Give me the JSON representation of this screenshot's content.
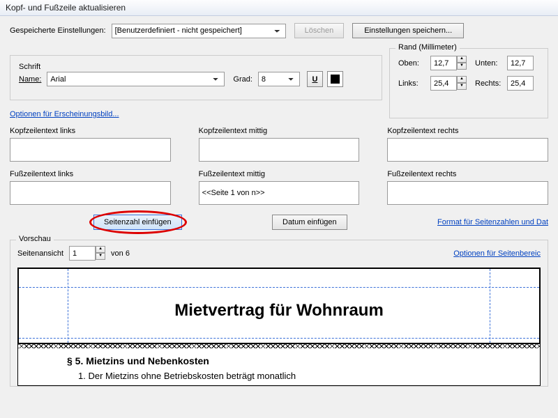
{
  "title": "Kopf- und Fußzeile aktualisieren",
  "saved": {
    "label": "Gespeicherte Einstellungen:",
    "value": "[Benutzerdefiniert - nicht gespeichert]",
    "delete": "Löschen",
    "save": "Einstellungen speichern..."
  },
  "font": {
    "legend": "Schrift",
    "name_label": "Name:",
    "name_value": "Arial",
    "grad_label": "Grad:",
    "grad_value": "8",
    "underline_icon": "U",
    "options_link": "Optionen für Erscheinungsbild..."
  },
  "margin": {
    "legend": "Rand (Millimeter)",
    "top_label": "Oben:",
    "top_value": "12,7",
    "bottom_label": "Unten:",
    "bottom_value": "12,7",
    "left_label": "Links:",
    "left_value": "25,4",
    "right_label": "Rechts:",
    "right_value": "25,4"
  },
  "hf": {
    "hl": "Kopfzeilentext links",
    "hc": "Kopfzeilentext mittig",
    "hr": "Kopfzeilentext rechts",
    "fl": "Fußzeilentext links",
    "fc": "Fußzeilentext mittig",
    "fr": "Fußzeilentext rechts",
    "hl_v": "",
    "hc_v": "",
    "hr_v": "",
    "fl_v": "",
    "fc_v": "<<Seite 1 von n>>",
    "fr_v": ""
  },
  "buttons": {
    "insert_page": "Seitenzahl einfügen",
    "insert_date": "Datum einfügen",
    "format_link": "Format für Seitenzahlen und Dat"
  },
  "preview": {
    "legend": "Vorschau",
    "pageview_label": "Seitenansicht",
    "page_value": "1",
    "of_label": "von 6",
    "range_link": "Optionen für Seitenbereic",
    "doc_title": "Mietvertrag für Wohnraum",
    "section_heading": "§ 5.   Mietzins und Nebenkosten",
    "section_item": "1.   Der Mietzins ohne Betriebskosten beträgt monatlich"
  }
}
